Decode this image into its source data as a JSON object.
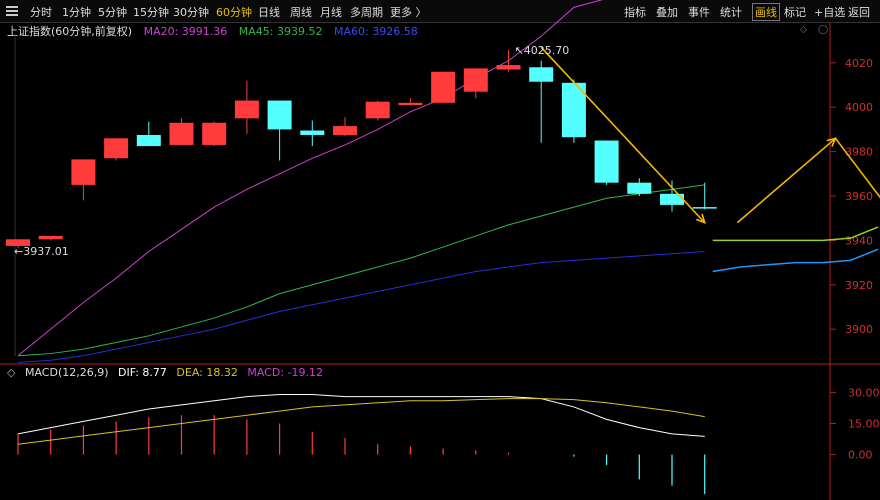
{
  "toolbar": {
    "left": [
      "分时",
      "1分钟",
      "5分钟",
      "15分钟",
      "30分钟",
      "60分钟",
      "日线",
      "周线",
      "月线",
      "多周期",
      "更多 〉"
    ],
    "active_index": 5,
    "right": [
      "指标",
      "叠加",
      "事件",
      "统计",
      "画线",
      "标记",
      "+自选",
      "返回"
    ],
    "right_active_index": 4
  },
  "main_legend": {
    "name": "上证指数(60分钟,前复权)",
    "ma20": "MA20: 3991.36",
    "ma45": "MA45: 3939.52",
    "ma60": "MA60: 3926.58"
  },
  "macd_legend": {
    "name": "MACD(12,26,9)",
    "dif": "DIF: 8.77",
    "dea": "DEA: 18.32",
    "macd": "MACD: -19.12"
  },
  "colors": {
    "up": "#ff3b3b",
    "down": "#54ffff",
    "ma20": "#d23fd2",
    "ma45": "#2fb84a",
    "ma60": "#2430d8",
    "dif": "#ffffff",
    "dea": "#d6c324",
    "drawing": "#f5b800",
    "forecast_green": "#9bd21e",
    "forecast_blue": "#1e96ff",
    "axis": "#b31d1d"
  },
  "chart_data": [
    {
      "type": "candlestick",
      "title": "上证指数(60分钟,前复权)",
      "y_ticks": [
        4020,
        4000,
        3980,
        3960,
        3940,
        3920,
        3900
      ],
      "ylim": [
        3887,
        4033
      ],
      "annotations": {
        "high_label": "4025.70",
        "high_value": 4025.7,
        "low_label": "3937.01",
        "low_value": 3937.01,
        "current_price": 3940
      },
      "candles": [
        {
          "o": 3937.5,
          "h": 3940.5,
          "l": 3936.5,
          "c": 3940.5
        },
        {
          "o": 3940.5,
          "h": 3942.0,
          "l": 3940.0,
          "c": 3942.0
        },
        {
          "o": 3965.0,
          "h": 3966.5,
          "l": 3958.0,
          "c": 3976.5
        },
        {
          "o": 3977.0,
          "h": 3985.0,
          "l": 3976.0,
          "c": 3986.0
        },
        {
          "o": 3987.5,
          "h": 3993.5,
          "l": 3984.0,
          "c": 3982.5
        },
        {
          "o": 3983.0,
          "h": 3995.0,
          "l": 3983.0,
          "c": 3993.0
        },
        {
          "o": 3983.0,
          "h": 3993.5,
          "l": 3982.5,
          "c": 3993.0
        },
        {
          "o": 3995.0,
          "h": 4012.0,
          "l": 3988.0,
          "c": 4003.0
        },
        {
          "o": 4003.0,
          "h": 4003.0,
          "l": 3976.0,
          "c": 3990.0
        },
        {
          "o": 3989.5,
          "h": 3994.0,
          "l": 3982.5,
          "c": 3987.5
        },
        {
          "o": 3987.5,
          "h": 3995.5,
          "l": 3987.0,
          "c": 3991.5
        },
        {
          "o": 3995.0,
          "h": 4003.0,
          "l": 3994.0,
          "c": 4002.5
        },
        {
          "o": 4001.0,
          "h": 4004.0,
          "l": 4001.0,
          "c": 4002.0
        },
        {
          "o": 4002.0,
          "h": 4016.0,
          "l": 4002.0,
          "c": 4016.0
        },
        {
          "o": 4007.0,
          "h": 4017.0,
          "l": 4004.0,
          "c": 4017.5
        },
        {
          "o": 4017.0,
          "h": 4025.7,
          "l": 4016.0,
          "c": 4019.0
        },
        {
          "o": 4018.0,
          "h": 4021.0,
          "l": 3984.0,
          "c": 4011.5
        },
        {
          "o": 4011.0,
          "h": 4012.5,
          "l": 3984.0,
          "c": 3986.5
        },
        {
          "o": 3985.0,
          "h": 3985.0,
          "l": 3965.0,
          "c": 3966.0
        },
        {
          "o": 3966.0,
          "h": 3968.0,
          "l": 3960.0,
          "c": 3961.0
        },
        {
          "o": 3961.0,
          "h": 3967.0,
          "l": 3953.0,
          "c": 3956.0
        },
        {
          "o": 3955.0,
          "h": 3966.0,
          "l": 3954.0,
          "c": 3954.5
        }
      ],
      "series": [
        {
          "name": "MA20",
          "values": [
            3888,
            3900,
            3912,
            3923,
            3935,
            3945,
            3955,
            3963,
            3970,
            3977,
            3983,
            3990,
            3998,
            4004,
            4013,
            4021,
            4032,
            4045,
            4049,
            4051,
            4052,
            4053
          ]
        },
        {
          "name": "MA45",
          "values": [
            3888,
            3889,
            3891,
            3894,
            3897,
            3901,
            3905,
            3910,
            3916,
            3920,
            3924,
            3928,
            3932,
            3937,
            3942,
            3947,
            3951,
            3955,
            3959,
            3961,
            3963,
            3965
          ]
        },
        {
          "name": "MA60",
          "values": [
            3885,
            3886,
            3888,
            3891,
            3894,
            3897,
            3900,
            3904,
            3908,
            3911,
            3914,
            3917,
            3920,
            3923,
            3926,
            3928,
            3930,
            3931,
            3932,
            3933,
            3934,
            3935
          ]
        }
      ],
      "drawings": [
        {
          "label": "down-trend",
          "from": [
            16,
            4027
          ],
          "to": [
            21,
            3948
          ]
        },
        {
          "label": "up-trend",
          "from": [
            22,
            3948
          ],
          "to": [
            25,
            3986
          ]
        },
        {
          "label": "down-trend-2",
          "from": [
            25,
            3986
          ],
          "to": [
            27,
            3947
          ]
        }
      ],
      "forecast": [
        {
          "name": "green",
          "values": [
            3940,
            3940,
            3940,
            3940,
            3940,
            3941,
            3946
          ]
        },
        {
          "name": "blue",
          "values": [
            3926,
            3928,
            3929,
            3930,
            3930,
            3931,
            3936
          ]
        }
      ]
    },
    {
      "type": "macd",
      "title": "MACD(12,26,9)",
      "y_ticks": [
        30.0,
        15.0,
        0.0
      ],
      "ylim": [
        -20,
        36
      ],
      "x_count": 22,
      "series": [
        {
          "name": "DIF",
          "values": [
            10,
            13,
            16,
            19,
            22,
            24,
            26,
            28,
            29,
            29,
            28,
            28,
            28,
            28,
            28,
            28,
            27,
            23,
            17,
            13,
            10,
            8.77
          ]
        },
        {
          "name": "DEA",
          "values": [
            5,
            7,
            9,
            11,
            13,
            15,
            17,
            19,
            21,
            23,
            24,
            25,
            26,
            26,
            26.5,
            27,
            27,
            26.5,
            25,
            23,
            21,
            18.32
          ]
        }
      ],
      "histogram": [
        10,
        12,
        14,
        16,
        18,
        19,
        19,
        17,
        15,
        11,
        8,
        5,
        4,
        3,
        2,
        1,
        0,
        -1,
        -5,
        -12,
        -15,
        -19.12
      ]
    }
  ]
}
